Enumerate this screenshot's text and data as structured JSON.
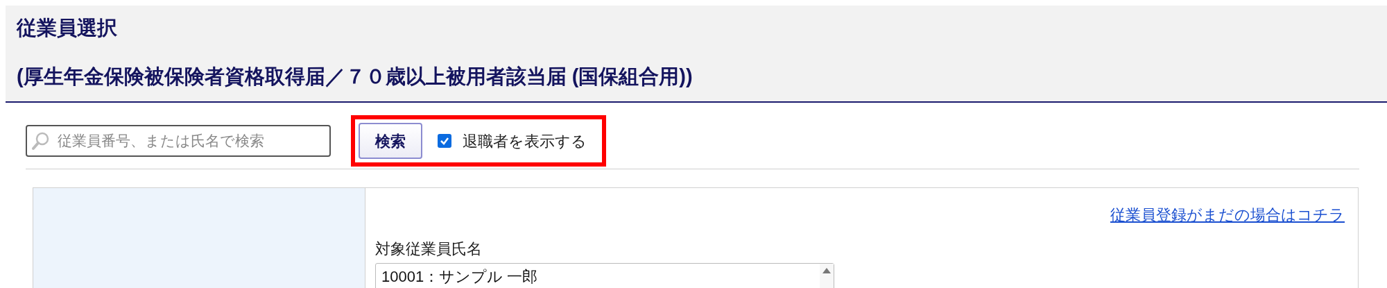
{
  "header": {
    "title": "従業員選択",
    "subtitle": "(厚生年金保険被保険者資格取得届／７０歳以上被用者該当届 (国保組合用))"
  },
  "toolbar": {
    "search": {
      "placeholder": "従業員番号、または氏名で検索"
    },
    "search_button": "検索",
    "show_retired": {
      "label": "退職者を表示する",
      "checked": true
    }
  },
  "panel": {
    "register_link": "従業員登録がまだの場合はコチラ",
    "employee_label": "対象従業員氏名",
    "employees": [
      {
        "label": "10001：サンプル 一郎",
        "selected": false
      }
    ]
  }
}
